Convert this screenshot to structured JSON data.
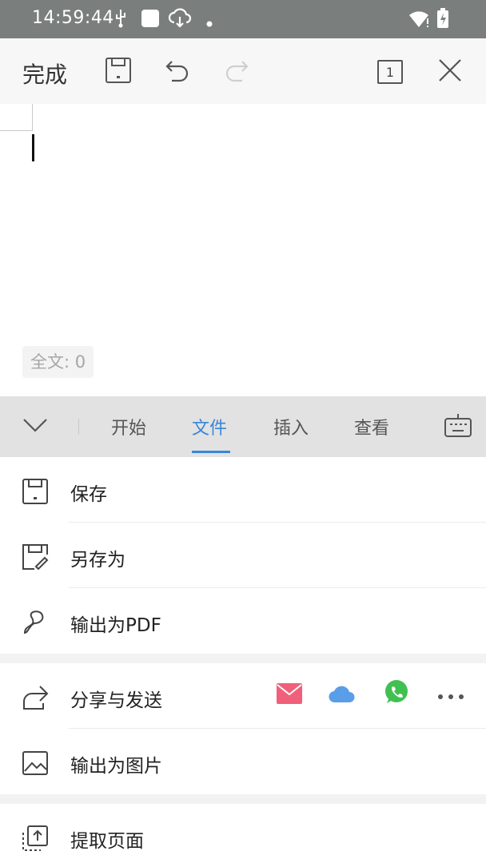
{
  "status_bar": {
    "time": "14:59:44"
  },
  "toolbar": {
    "done_label": "完成",
    "page_count": "1"
  },
  "document": {
    "word_count": "全文: 0"
  },
  "tabs": [
    {
      "label": "开始",
      "active": false
    },
    {
      "label": "文件",
      "active": true
    },
    {
      "label": "插入",
      "active": false
    },
    {
      "label": "查看",
      "active": false
    }
  ],
  "menu": {
    "save": "保存",
    "save_as": "另存为",
    "export_pdf": "输出为PDF",
    "share": "分享与发送",
    "export_image": "输出为图片",
    "extract_pages": "提取页面"
  },
  "colors": {
    "accent": "#3a86d9",
    "status_bar_bg": "#7a7f7e",
    "mail_red": "#f0607a",
    "cloud_blue": "#5a9de8",
    "whatsapp_green": "#41c052"
  }
}
